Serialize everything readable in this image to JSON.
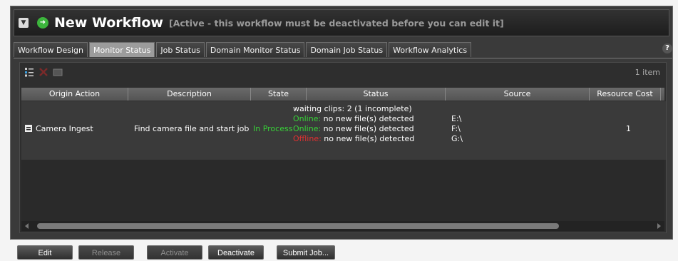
{
  "title": "New Workflow",
  "title_note": "[Active - this workflow must be deactivated before you can edit it]",
  "help_label": "?",
  "tabs": [
    "Workflow Design",
    "Monitor Status",
    "Job Status",
    "Domain Monitor Status",
    "Domain Job Status",
    "Workflow Analytics"
  ],
  "active_tab": "Monitor Status",
  "item_count": "1 item",
  "columns": [
    "Origin Action",
    "Description",
    "State",
    "Status",
    "Source",
    "Resource Cost"
  ],
  "row": {
    "origin_action": "Camera Ingest",
    "description": "Find camera file and start job",
    "state": "In Process",
    "status_head": "waiting clips: 2 (1 incomplete)",
    "status_lines": [
      {
        "state": "Online:",
        "text": " no new file(s) detected",
        "source": "E:\\"
      },
      {
        "state": "Online:",
        "text": " no new file(s) detected",
        "source": "F:\\"
      },
      {
        "state": "Offline:",
        "text": " no new file(s) detected",
        "source": "G:\\"
      }
    ],
    "resource_cost": "1"
  },
  "buttons": {
    "edit": "Edit",
    "release": "Release",
    "activate": "Activate",
    "deactivate": "Deactivate",
    "submit_job": "Submit Job..."
  },
  "colors": {
    "online": "#37d337",
    "offline": "#e23030",
    "in_process": "#37d337"
  }
}
